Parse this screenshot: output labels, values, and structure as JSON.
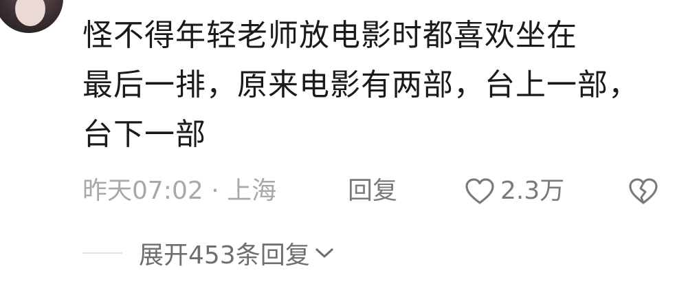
{
  "comment": {
    "line1": "怪不得年轻老师放电影时都喜欢坐在",
    "line2": "最后一排，原来电影有两部，台上一部，",
    "line3": "台下一部"
  },
  "meta": {
    "time_location": "昨天07:02 · 上海",
    "reply_label": "回复",
    "like_count": "2.3万"
  },
  "replies": {
    "expand_label": "展开453条回复"
  },
  "icons": {
    "like": "heart-outline-icon",
    "dislike": "broken-heart-icon",
    "expand": "chevron-down-icon"
  },
  "colors": {
    "text_primary": "#1a1a1a",
    "text_secondary": "#a8a8a8",
    "action": "#7a7a7a"
  }
}
